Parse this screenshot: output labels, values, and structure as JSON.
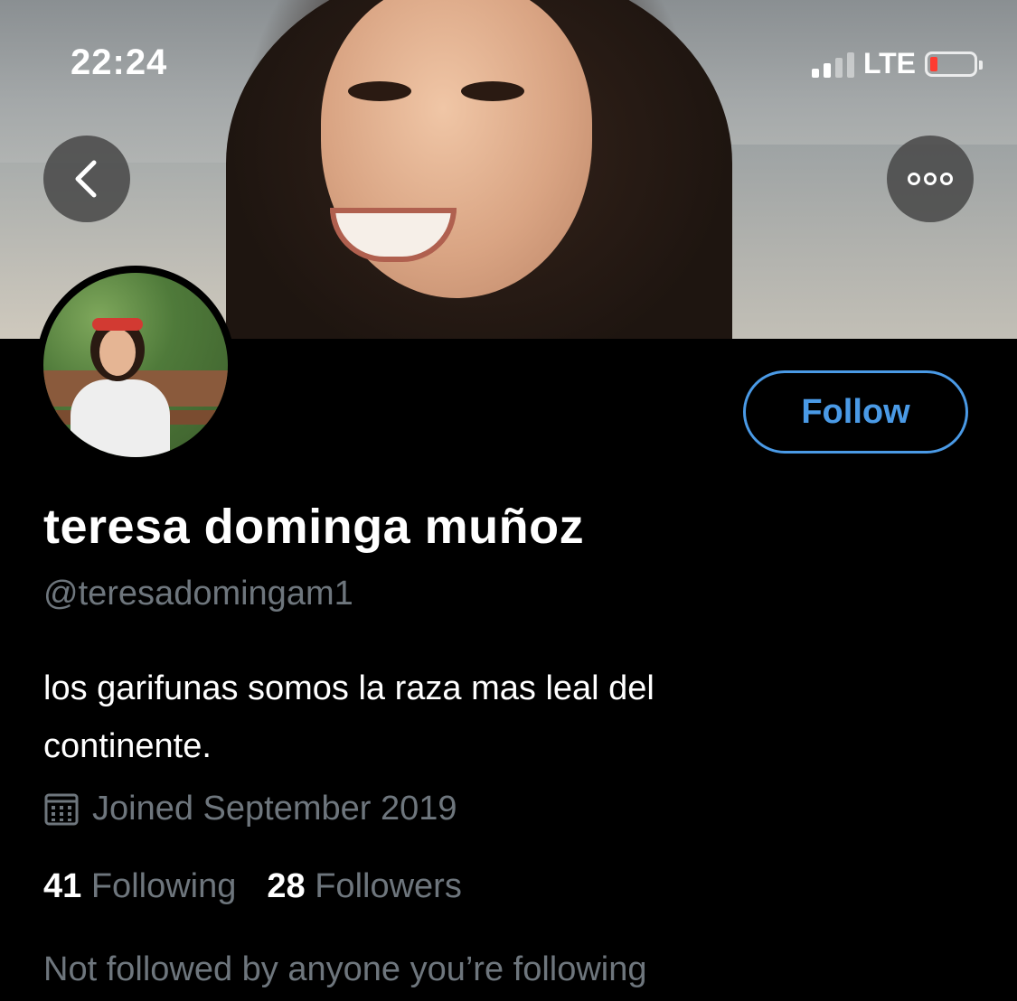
{
  "status_bar": {
    "time": "22:24",
    "network": "LTE",
    "battery_level": 0.1,
    "signal_bars": 2
  },
  "nav": {
    "back_icon": "chevron-left-icon",
    "more_icon": "more-horizontal-icon"
  },
  "profile": {
    "name": "teresa dominga muñoz",
    "handle": "@teresadomingam1",
    "bio_line1": "los garifunas somos la raza mas leal del",
    "bio_line2": "continente.",
    "joined": "Joined September 2019",
    "following_count": "41",
    "following_label": "Following",
    "followers_count": "28",
    "followers_label": "Followers",
    "mutuals_note": "Not followed by anyone you’re following"
  },
  "actions": {
    "follow_label": "Follow"
  },
  "colors": {
    "accent": "#4a9ae6",
    "secondary_text": "#6e767d",
    "background": "#000000"
  }
}
